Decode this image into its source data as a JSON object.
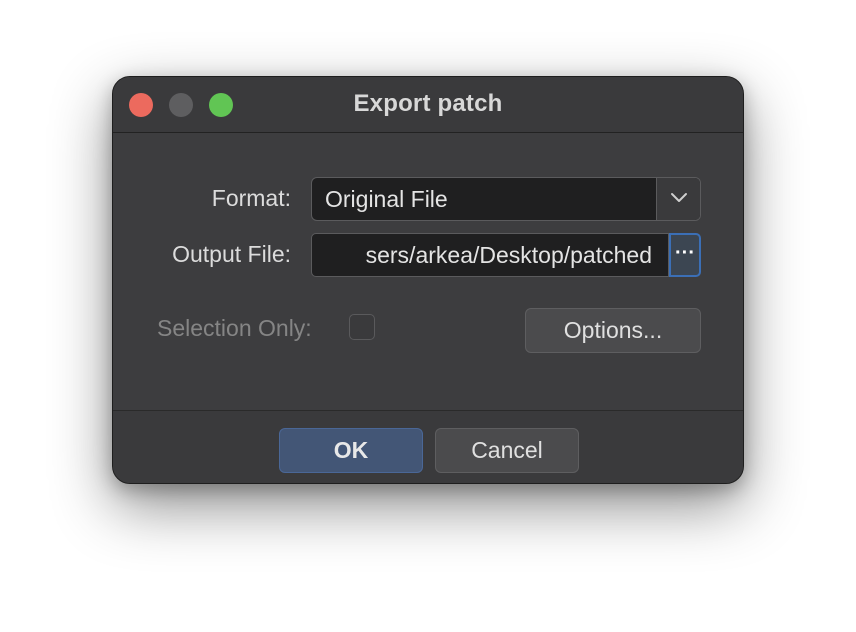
{
  "window": {
    "title": "Export patch"
  },
  "form": {
    "format_label": "Format:",
    "format_value": "Original File",
    "output_label": "Output File:",
    "output_value": "sers/arkea/Desktop/patched",
    "browse_label": "···",
    "selection_label": "Selection Only:",
    "selection_checked": false,
    "options_label": "Options..."
  },
  "footer": {
    "ok_label": "OK",
    "cancel_label": "Cancel"
  },
  "icons": {
    "close": "close-traffic-light",
    "minimize": "minimize-traffic-light",
    "maximize": "maximize-traffic-light",
    "dropdown": "chevron-down-icon"
  },
  "colors": {
    "close": "#ec6a5e",
    "maximize": "#61c554",
    "accent": "#3b6fb6",
    "ok_button": "#435676"
  }
}
